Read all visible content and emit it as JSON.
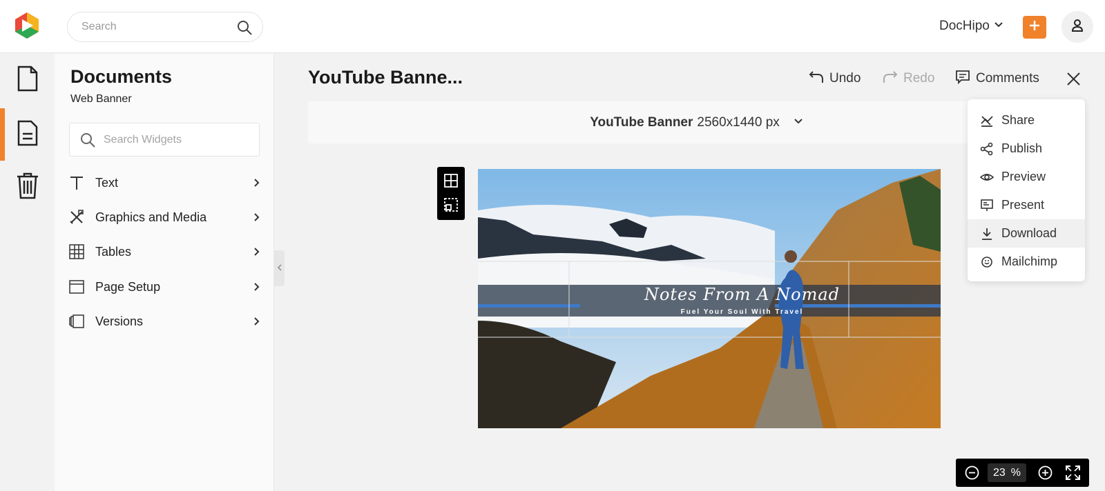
{
  "header": {
    "search_placeholder": "Search",
    "workspace": "DocHipo",
    "accent_color": "#f0822c"
  },
  "rail": {
    "items": [
      {
        "icon": "document-icon",
        "active": false
      },
      {
        "icon": "document-lines-icon",
        "active": true
      },
      {
        "icon": "trash-icon",
        "active": false
      }
    ]
  },
  "panel": {
    "title": "Documents",
    "subtitle": "Web Banner",
    "search_placeholder": "Search Widgets",
    "items": [
      {
        "label": "Text",
        "icon": "text-icon"
      },
      {
        "label": "Graphics and Media",
        "icon": "graphics-icon"
      },
      {
        "label": "Tables",
        "icon": "table-icon"
      },
      {
        "label": "Page Setup",
        "icon": "page-setup-icon"
      },
      {
        "label": "Versions",
        "icon": "versions-icon"
      }
    ]
  },
  "document": {
    "title": "YouTube Banne...",
    "undo": "Undo",
    "redo": "Redo",
    "comments": "Comments",
    "size_name": "YouTube Banner",
    "size_dims": "2560x1440 px"
  },
  "banner": {
    "title": "Notes From A Nomad",
    "subtitle": "Fuel Your Soul With Travel"
  },
  "dropdown": {
    "items": [
      {
        "label": "Share",
        "icon": "share-icon"
      },
      {
        "label": "Publish",
        "icon": "publish-icon"
      },
      {
        "label": "Preview",
        "icon": "eye-icon"
      },
      {
        "label": "Present",
        "icon": "present-icon"
      },
      {
        "label": "Download",
        "icon": "download-icon",
        "hover": true
      },
      {
        "label": "Mailchimp",
        "icon": "mailchimp-icon"
      }
    ]
  },
  "zoom": {
    "value": "23",
    "unit": "%"
  }
}
